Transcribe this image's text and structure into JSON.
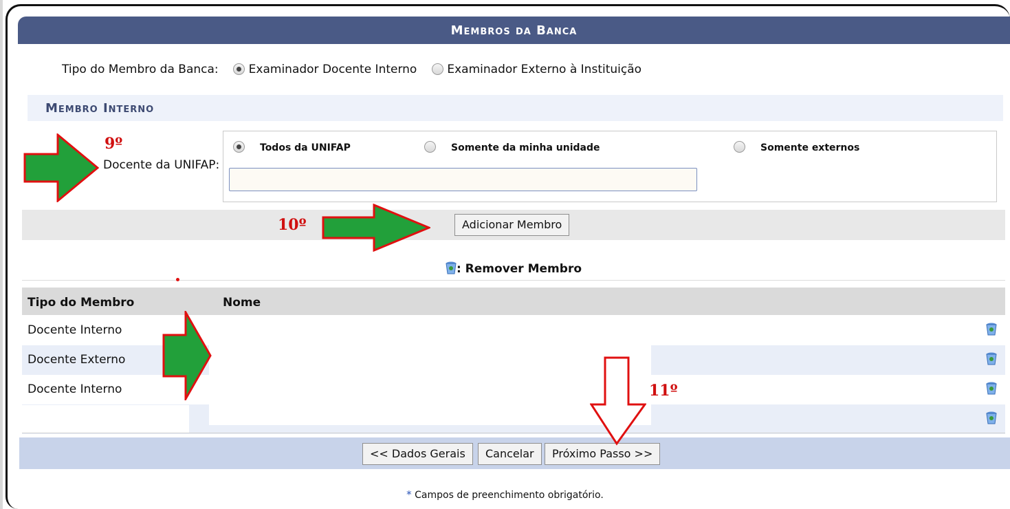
{
  "panel": {
    "title": "Membros da Banca"
  },
  "member_type": {
    "label": "Tipo do Membro da Banca:",
    "options": [
      {
        "label": "Examinador Docente Interno",
        "selected": true
      },
      {
        "label": "Examinador Externo à Instituição",
        "selected": false
      }
    ]
  },
  "internal_member": {
    "header": "Membro Interno",
    "docente_label": "Docente da UNIFAP:",
    "scope_options": [
      {
        "label": "Todos da UNIFAP",
        "selected": true
      },
      {
        "label": "Somente da minha unidade",
        "selected": false
      },
      {
        "label": "Somente externos",
        "selected": false
      }
    ],
    "input_value": "",
    "add_button": "Adicionar Membro"
  },
  "legend": {
    "remove_label": ": Remover Membro",
    "remove_icon": "trash-icon"
  },
  "table": {
    "columns": [
      "Tipo do Membro",
      "Nome"
    ],
    "rows": [
      {
        "tipo": "Docente Interno",
        "nome": ""
      },
      {
        "tipo": "Docente Externo",
        "nome": ""
      },
      {
        "tipo": "Docente Interno",
        "nome": ""
      },
      {
        "tipo": "",
        "nome": ""
      }
    ]
  },
  "footer": {
    "back_button": "<< Dados Gerais",
    "cancel_button": "Cancelar",
    "next_button": "Próximo Passo >>",
    "mandatory_note": "Campos de preenchimento obrigatório."
  },
  "annotations": {
    "step_9": "9º",
    "step_10": "10º",
    "step_11": "11º",
    "arrow_fill": "#22a03a",
    "arrow_stroke": "#e01010"
  },
  "colors": {
    "title_bar": "#4a5a86",
    "sub_header_bg": "#eef2fa",
    "row_alt": "#e9eef8",
    "footer_bar": "#c8d3ea"
  }
}
